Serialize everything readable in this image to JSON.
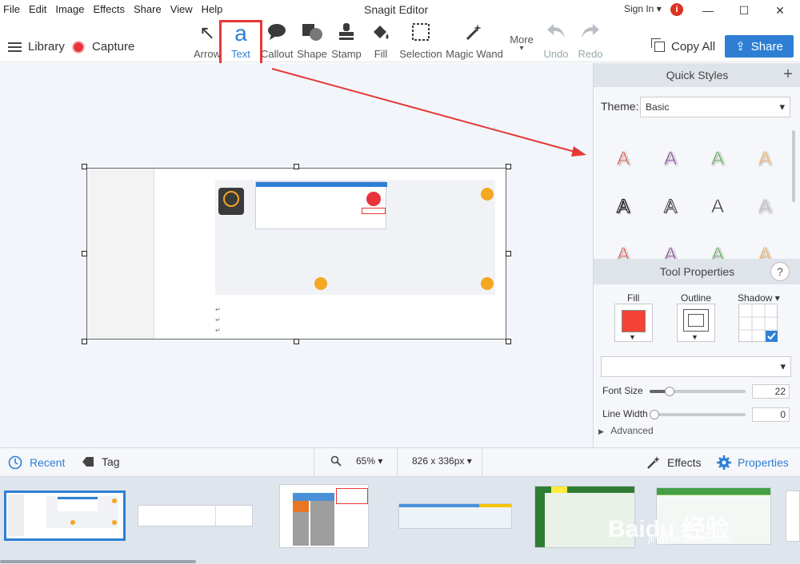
{
  "menu": [
    "File",
    "Edit",
    "Image",
    "Effects",
    "Share",
    "View",
    "Help"
  ],
  "window_title": "Snagit Editor",
  "signin": "Sign In ▾",
  "window_controls": {
    "minimize": "—",
    "maximize": "☐",
    "close": "✕"
  },
  "toolbar": {
    "library_label": "Library",
    "capture_label": "Capture",
    "tools": [
      {
        "label": "Arrow",
        "icon": "arrow-icon",
        "glyph": "↖"
      },
      {
        "label": "Text",
        "icon": "text-icon",
        "glyph": "a",
        "selected": true
      },
      {
        "label": "Callout",
        "icon": "callout-icon",
        "glyph": "💬"
      },
      {
        "label": "Shape",
        "icon": "shape-icon",
        "glyph": "◼"
      },
      {
        "label": "Stamp",
        "icon": "stamp-icon",
        "glyph": "⊥"
      },
      {
        "label": "Fill",
        "icon": "fill-icon",
        "glyph": "⛉"
      },
      {
        "label": "Selection",
        "icon": "selection-icon",
        "glyph": "⬚"
      },
      {
        "label": "Magic Wand",
        "icon": "magic-wand-icon",
        "glyph": "⁂"
      },
      {
        "label": "More",
        "icon": "more-icon",
        "glyph": "▾"
      },
      {
        "label": "Undo",
        "icon": "undo-icon",
        "glyph": "↶",
        "disabled": true
      },
      {
        "label": "Redo",
        "icon": "redo-icon",
        "glyph": "↷",
        "disabled": true
      }
    ],
    "copy_all_label": "Copy All",
    "share_label": "Share"
  },
  "quick_styles": {
    "title": "Quick Styles",
    "theme_label": "Theme:",
    "theme_value": "Basic",
    "glyph": "A"
  },
  "tool_properties": {
    "title": "Tool Properties",
    "fill_label": "Fill",
    "outline_label": "Outline",
    "shadow_label": "Shadow ▾",
    "fill_color": "#f44336",
    "font_size_label": "Font Size",
    "font_size_value": "22",
    "line_width_label": "Line Width",
    "line_width_value": "0",
    "advanced_label": "Advanced"
  },
  "statusbar": {
    "recent_label": "Recent",
    "tag_label": "Tag",
    "zoom_value": "65% ▾",
    "dimensions_value": "826 x 336px ▾",
    "effects_label": "Effects",
    "properties_label": "Properties"
  },
  "watermark": "Baidu 经验",
  "watermark_url": "jingyan.baidu.com",
  "colors": {
    "accent": "#2e7fd4",
    "highlight": "#e53935",
    "orange": "#f5a623"
  }
}
